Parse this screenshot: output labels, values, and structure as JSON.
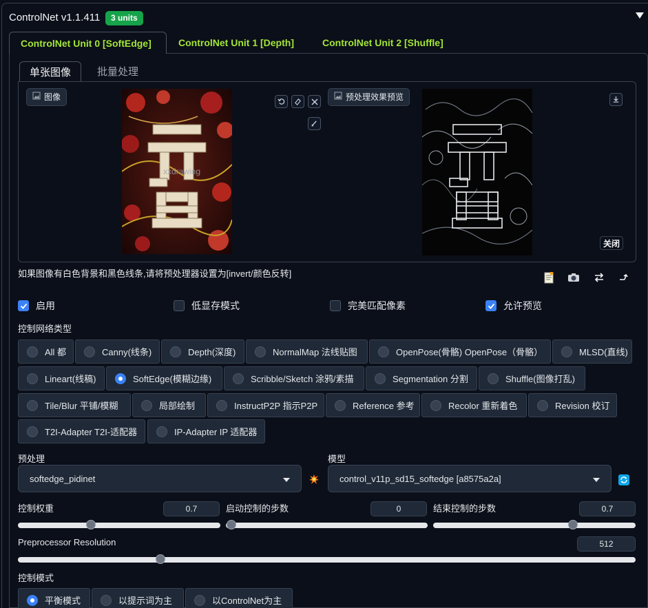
{
  "header": {
    "title": "ControlNet v1.1.411",
    "badge": "3 units",
    "collapse_icon": "triangle-down-icon"
  },
  "unit_tabs": [
    {
      "label": "ControlNet Unit 0 [SoftEdge]",
      "active": true
    },
    {
      "label": "ControlNet Unit 1 [Depth]",
      "active": false
    },
    {
      "label": "ControlNet Unit 2 [Shuffle]",
      "active": false
    }
  ],
  "sub_tabs": [
    {
      "label": "单张图像",
      "active": true
    },
    {
      "label": "批量处理",
      "active": false
    }
  ],
  "image_panel": {
    "input_label": "图像",
    "preview_label": "预处理效果预览",
    "close_label": "关闭",
    "watermark_text": "xxdrawing"
  },
  "hint": "如果图像有白色背景和黑色线条,请将预处理器设置为[invert/颜色反转]",
  "checkboxes": [
    {
      "label": "启用",
      "checked": true
    },
    {
      "label": "低显存模式",
      "checked": false
    },
    {
      "label": "完美匹配像素",
      "checked": false
    },
    {
      "label": "允许预览",
      "checked": true
    }
  ],
  "control_type": {
    "label": "控制网络类型",
    "options": [
      {
        "label": "All 都",
        "selected": false
      },
      {
        "label": "Canny(线条)",
        "selected": false
      },
      {
        "label": "Depth(深度)",
        "selected": false
      },
      {
        "label": "NormalMap 法线贴图",
        "selected": false
      },
      {
        "label": "OpenPose(骨骼) OpenPose（骨骼）",
        "selected": false
      },
      {
        "label": "MLSD(直线)",
        "selected": false
      },
      {
        "label": "Lineart(线稿)",
        "selected": false
      },
      {
        "label": "SoftEdge(模糊边缘)",
        "selected": true
      },
      {
        "label": "Scribble/Sketch 涂鸦/素描",
        "selected": false
      },
      {
        "label": "Segmentation 分割",
        "selected": false
      },
      {
        "label": "Shuffle(图像打乱)",
        "selected": false
      },
      {
        "label": "Tile/Blur 平铺/模糊",
        "selected": false
      },
      {
        "label": "局部绘制",
        "selected": false
      },
      {
        "label": "InstructP2P 指示P2P",
        "selected": false
      },
      {
        "label": "Reference 参考",
        "selected": false
      },
      {
        "label": "Recolor 重新着色",
        "selected": false
      },
      {
        "label": "Revision 校订",
        "selected": false
      },
      {
        "label": "T2I-Adapter T2I-适配器",
        "selected": false
      },
      {
        "label": "IP-Adapter IP 适配器",
        "selected": false
      }
    ]
  },
  "preprocessor": {
    "label": "预处理",
    "value": "softedge_pidinet"
  },
  "model": {
    "label": "模型",
    "value": "control_v11p_sd15_softedge [a8575a2a]"
  },
  "sliders": {
    "weight": {
      "label": "控制权重",
      "value": "0.7",
      "fraction": 0.35
    },
    "start": {
      "label": "启动控制的步数",
      "value": "0",
      "fraction": 0.0
    },
    "end": {
      "label": "结束控制的步数",
      "value": "0.7",
      "fraction": 0.7
    },
    "resolution": {
      "label": "Preprocessor Resolution",
      "value": "512",
      "fraction": 0.23
    }
  },
  "control_mode": {
    "label": "控制模式",
    "options": [
      {
        "label": "平衡模式",
        "selected": true
      },
      {
        "label": "以提示词为主",
        "selected": false
      },
      {
        "label": "以ControlNet为主",
        "selected": false
      }
    ]
  }
}
